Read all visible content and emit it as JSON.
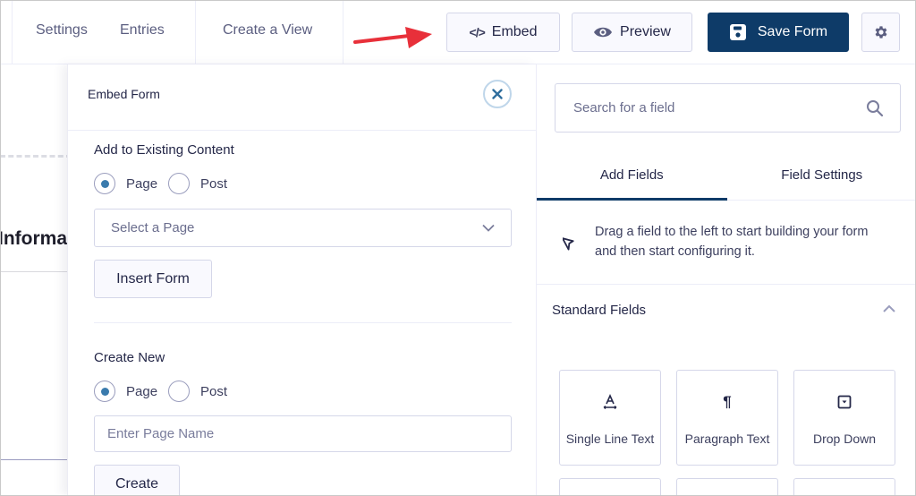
{
  "topbar": {
    "nav": [
      "Settings",
      "Entries",
      "Create a View"
    ],
    "embed_label": "Embed",
    "preview_label": "Preview",
    "save_label": "Save Form",
    "accent_color": "#0e3b68",
    "annotation_arrow_color": "#e8303a"
  },
  "canvas": {
    "partial_heading": "Informa"
  },
  "embed_panel": {
    "title": "Embed Form",
    "existing": {
      "label": "Add to Existing Content",
      "options": [
        {
          "label": "Page",
          "checked": true
        },
        {
          "label": "Post",
          "checked": false
        }
      ],
      "select_placeholder": "Select a Page",
      "button_label": "Insert Form"
    },
    "create_new": {
      "label": "Create New",
      "options": [
        {
          "label": "Page",
          "checked": true
        },
        {
          "label": "Post",
          "checked": false
        }
      ],
      "input_placeholder": "Enter Page Name",
      "input_value": "",
      "button_label": "Create"
    }
  },
  "sidebar": {
    "search_placeholder": "Search for a field",
    "tabs": [
      {
        "label": "Add Fields",
        "active": true
      },
      {
        "label": "Field Settings",
        "active": false
      }
    ],
    "hint": "Drag a field to the left to start building your form and then start configuring it.",
    "standard_fields": {
      "title": "Standard Fields",
      "expanded": true,
      "fields": [
        {
          "label": "Single Line Text",
          "icon": "text-input-icon"
        },
        {
          "label": "Paragraph Text",
          "icon": "paragraph-icon"
        },
        {
          "label": "Drop Down",
          "icon": "dropdown-icon"
        }
      ]
    }
  }
}
